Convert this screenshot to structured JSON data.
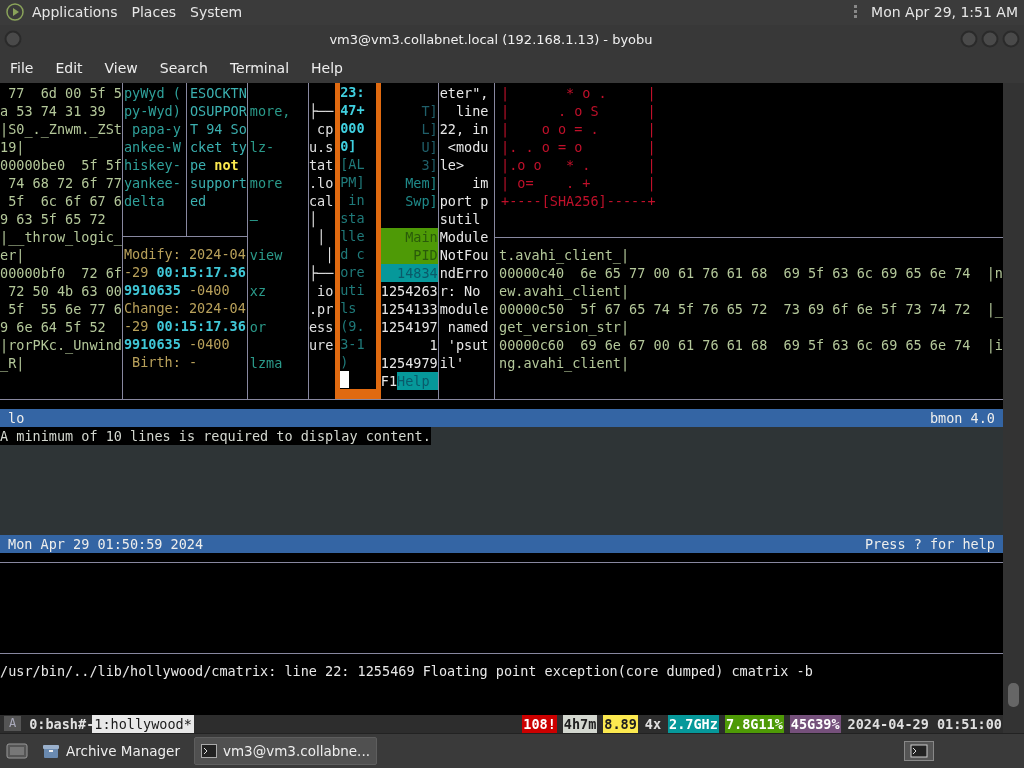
{
  "top_panel": {
    "menus": [
      "Applications",
      "Places",
      "System"
    ],
    "clock": "Mon Apr 29, 1:51 AM"
  },
  "window": {
    "title": "vm3@vm3.collabnet.local (192.168.1.13) - byobu",
    "menu": [
      "File",
      "Edit",
      "View",
      "Search",
      "Terminal",
      "Help"
    ]
  },
  "panes": {
    "hexdump_left": [
      " 77  6d 00 5f 5",
      "a 53 74 31 39",
      "|S0_._Znwm._ZSt",
      "19|",
      "00000be0  5f 5f",
      " 74 68 72 6f 77",
      " 5f  6c 6f 67 6",
      "9 63 5f 65 72",
      "|__throw_logic_",
      "er|",
      "00000bf0  72 6f",
      " 72 50 4b 63 00",
      " 5f  55 6e 77 6",
      "9 6e 64 5f 52",
      "|rorPKc._Unwind",
      "_R|"
    ],
    "callsign": [
      "pyWyd (",
      "py-Wyd)",
      " papa-y",
      "ankee-W",
      "hiskey-",
      "yankee-",
      "delta"
    ],
    "error": [
      "ESOCKTN",
      "OSUPPOR",
      "T 94 So",
      "cket ty",
      "pe **not**",
      "support",
      "ed"
    ],
    "stat": [
      "Modify: 2024-04",
      "-29 **00:15:17.36**",
      "**9910635** -0400",
      "Change: 2024-04",
      "-29 **00:15:17.36**",
      "**9910635** -0400",
      " Birth: -"
    ],
    "apt": [
      "more,",
      "lz-",
      "more",
      "–",
      "view",
      "xz",
      "or",
      "lzma"
    ],
    "tree": [
      "├──",
      " cp",
      "u.s",
      "tat",
      ".lo",
      "cal",
      "│",
      " │",
      "  │",
      "├──",
      " io",
      ".pr",
      "ess",
      "ure"
    ],
    "matrix": [
      {
        "text": "23:",
        "bold": true
      },
      {
        "text": "47+",
        "bold": true
      },
      {
        "text": "000",
        "bold": true
      },
      {
        "text": "0]",
        "bold": true
      },
      {
        "text": "[AL",
        "bold": false
      },
      {
        "text": "PM]",
        "bold": false
      },
      {
        "text": " in",
        "bold": false
      },
      {
        "text": "sta",
        "bold": false
      },
      {
        "text": "lle",
        "bold": false
      },
      {
        "text": "d c",
        "bold": false
      },
      {
        "text": "ore",
        "bold": false
      },
      {
        "text": "uti",
        "bold": false
      },
      {
        "text": "ls",
        "bold": false
      },
      {
        "text": "(9.",
        "bold": false
      },
      {
        "text": "3-1",
        "bold": false
      },
      {
        "text": ")",
        "bold": false
      }
    ],
    "htop": [
      {
        "kind": "dim",
        "text": "T]"
      },
      {
        "kind": "dim",
        "text": "L]"
      },
      {
        "kind": "dim",
        "text": "U]"
      },
      {
        "kind": "dim",
        "text": "3]"
      },
      {
        "kind": "meter",
        "text": "Mem]"
      },
      {
        "kind": "meter",
        "text": "Swp]"
      },
      {
        "kind": "header",
        "text": "Main"
      },
      {
        "kind": "header",
        "text": "PID"
      },
      {
        "kind": "selected",
        "text": "14834"
      },
      {
        "kind": "plain",
        "text": "1254263"
      },
      {
        "kind": "plain",
        "text": "1254133"
      },
      {
        "kind": "plain",
        "text": "1254197"
      },
      {
        "kind": "plain",
        "text": "1"
      },
      {
        "kind": "plain",
        "text": "1254979"
      },
      {
        "kind": "key",
        "key": "F1",
        "text": "Help"
      }
    ],
    "traceback": [
      "eter\",",
      "  line",
      "22, in",
      " <modu",
      "le>",
      "    im",
      "port p",
      "sutil",
      "Module",
      "NotFou",
      "ndErro",
      "r: No",
      "module",
      " named",
      " 'psut",
      "il'"
    ],
    "randomart": [
      "|       * o .     |",
      "|      . o S      |",
      "|    o o = .      |",
      "|. . o = o        |",
      "|.o o   * .       |",
      "| o=    . +       |",
      "+----[SHA256]-----+"
    ],
    "hexdump_right": [
      "t.avahi_client_|",
      "00000c40  6e 65 77 00 61 76 61 68  69 5f 63 6c 69 65 6e 74  |n",
      "ew.avahi_client|",
      "00000c50  5f 67 65 74 5f 76 65 72  73 69 6f 6e 5f 73 74 72  |_",
      "get_version_str|",
      "00000c60  69 6e 67 00 61 76 61 68  69 5f 63 6c 69 65 6e 74  |i",
      "ng.avahi_client|"
    ]
  },
  "bmon": {
    "interface": "lo",
    "version": "bmon 4.0",
    "message": "A minimum of 10 lines is required to display content.",
    "time": "Mon Apr 29 01:50:59 2024",
    "help": "Press ? for help"
  },
  "output": "/usr/bin/../lib/hollywood/cmatrix: line 22: 1255469 Floating point exception(core dumped) cmatrix -b",
  "status_bar": {
    "session": "A",
    "windows": [
      {
        "label": "0:bash#-",
        "selected": false
      },
      {
        "label": "1:hollywood*",
        "selected": true
      }
    ],
    "segments": [
      {
        "text": "108!",
        "color": "#cc0000"
      },
      {
        "text": "4h7m",
        "color": "#d3d7cf"
      },
      {
        "text": "8.89",
        "color": "#fce94f"
      },
      {
        "text": "4x"
      },
      {
        "text": "2.7GHz",
        "color": "#06989a"
      },
      {
        "text": "7.8G11%",
        "color": "#4e9a06"
      },
      {
        "text": "45G39%",
        "color": "#75507b"
      },
      {
        "text": "2024-04-29 01:51:00"
      }
    ]
  },
  "taskbar": {
    "items": [
      {
        "label": "Archive Manager",
        "selected": false
      },
      {
        "label": "vm3@vm3.collabne...",
        "selected": true
      }
    ]
  }
}
